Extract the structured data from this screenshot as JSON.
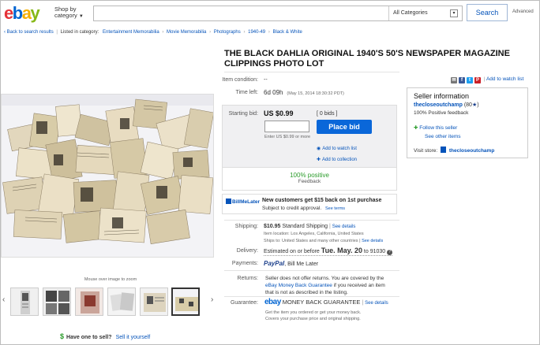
{
  "header": {
    "logo_letters": [
      "e",
      "b",
      "a",
      "y"
    ],
    "shop_by": "Shop by",
    "shop_by_2": "category",
    "search_placeholder": "",
    "category": "All Categories",
    "search_button": "Search",
    "advanced": "Advanced"
  },
  "breadcrumb": {
    "back": "Back to search results",
    "listed": "Listed in category:",
    "items": [
      "Entertainment Memorabilia",
      "Movie Memorabilia",
      "Photographs",
      "1940-49",
      "Black & White"
    ]
  },
  "left": {
    "mouse_over": "Mouse over image to zoom",
    "have_one": "Have one to sell?",
    "sell_it": "Sell it yourself"
  },
  "listing": {
    "title": "THE BLACK DAHLIA ORIGINAL 1940'S 50'S NEWSPAPER MAGAZINE CLIPPINGS PHOTO LOT",
    "condition_label": "Item condition:",
    "condition_value": "--",
    "time_left_label": "Time left:",
    "time_left_value": "6d 09h",
    "time_left_date": "(May 15, 2014   18:30:32 PDT)",
    "starting_bid_label": "Starting bid:",
    "starting_bid": "US $0.99",
    "bids": "[ 0 bids ]",
    "enter_hint": "Enter US $0.99 or more",
    "place_bid": "Place bid",
    "add_watch": "Add to watch list",
    "add_collection": "Add to collection",
    "positive": "100% positive",
    "feedback": "Feedback",
    "bml_logo": "BillMeLater",
    "bml_line1": "New customers get $15 back on 1st purchase",
    "bml_line2": "Subject to credit approval.",
    "see_terms": "See terms",
    "shipping_label": "Shipping:",
    "shipping_price": "$10.95",
    "shipping_method": "Standard Shipping",
    "see_details": "See details",
    "item_location": "Item location: Los Angeles, California, United States",
    "ships_to_label": "Ships to:",
    "ships_to": "United States and many other countries",
    "delivery_label": "Delivery:",
    "delivery_text": "Estimated on or before",
    "delivery_date": "Tue. May. 20",
    "delivery_to": "to",
    "delivery_zip": "91030",
    "payments_label": "Payments:",
    "paypal": "PayPal",
    "bill_me_later": "Bill Me Later",
    "returns_label": "Returns:",
    "returns_text_1": "Seller does not offer returns. You are covered by the",
    "returns_link": "eBay Money Back Guarantee",
    "returns_text_2": "if you received an item",
    "returns_text_3": "that is not as described in the listing.",
    "guarantee_label": "Guarantee:",
    "guarantee_logo": "ebay",
    "guarantee_name": "MONEY BACK GUARANTEE",
    "guarantee_see": "See details",
    "guarantee_text_1": "Get the item you ordered or get your money back.",
    "guarantee_text_2": "Covers your purchase price and original shipping."
  },
  "share": {
    "add_to_watch": "Add to watch list"
  },
  "seller": {
    "heading": "Seller information",
    "name": "thecloseoutchamp",
    "score": "(80",
    "score_end": ")",
    "positive": "100% Positive feedback",
    "follow": "Follow this seller",
    "see_items": "See other items",
    "visit_label": "Visit store:",
    "store": "thecloseoutchamp"
  },
  "colors": {
    "link": "#0654ba",
    "bid_button": "#0a67d9",
    "positive_green": "#2c9c2c"
  }
}
